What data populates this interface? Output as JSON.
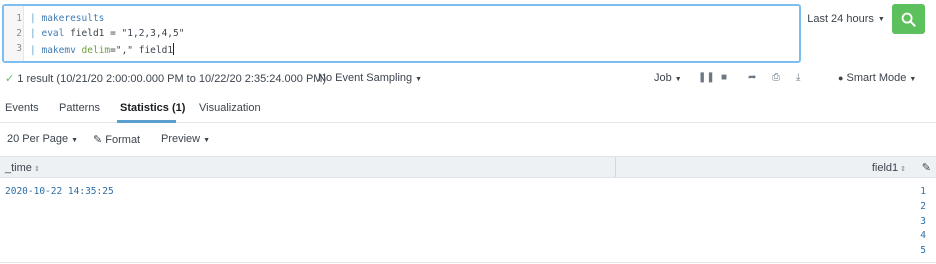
{
  "search": {
    "lines": [
      {
        "num": "1",
        "pipe": "|",
        "cmd": "makeresults",
        "rest": ""
      },
      {
        "num": "2",
        "pipe": "|",
        "cmd": "eval",
        "rest": " field1 = \"1,2,3,4,5\""
      },
      {
        "num": "3",
        "pipe": "|",
        "cmd": "makemv",
        "kw": "delim",
        "rest": "=\",\" field1"
      }
    ],
    "time_range": "Last 24 hours",
    "search_icon": "search-icon"
  },
  "status": {
    "result_text": "1 result (10/21/20 2:00:00.000 PM to 10/22/20 2:35:24.000 PM)",
    "sampling": "No Event Sampling",
    "job": "Job",
    "mode": "Smart Mode"
  },
  "tabs": [
    "Events",
    "Patterns",
    "Statistics (1)",
    "Visualization"
  ],
  "toolbar": {
    "per_page": "20 Per Page",
    "format": "Format",
    "preview": "Preview"
  },
  "table": {
    "columns": [
      "_time",
      "field1"
    ],
    "rows": [
      {
        "time": "2020-10-22 14:35:25",
        "field1": [
          "1",
          "2",
          "3",
          "4",
          "5"
        ]
      }
    ]
  },
  "colors": {
    "accent": "#5a9fcf",
    "search_button": "#5cc05c"
  }
}
